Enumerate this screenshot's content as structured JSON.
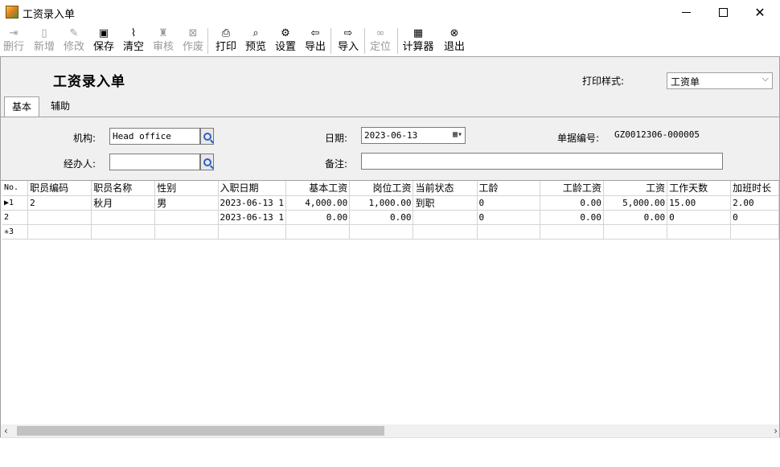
{
  "window": {
    "title": "工资录入单"
  },
  "toolbar": {
    "buttons": [
      {
        "label": "删行",
        "icon": "delete-row-icon",
        "glyph": "⇥",
        "disabled": true
      },
      {
        "label": "新增",
        "icon": "new-doc-icon",
        "glyph": "▯",
        "disabled": true
      },
      {
        "label": "修改",
        "icon": "edit-icon",
        "glyph": "✎",
        "disabled": true
      },
      {
        "label": "保存",
        "icon": "save-icon",
        "glyph": "▣",
        "disabled": false
      },
      {
        "label": "清空",
        "icon": "broom-icon",
        "glyph": "⌇",
        "disabled": false
      },
      {
        "label": "审核",
        "icon": "stamp-icon",
        "glyph": "♜",
        "disabled": true
      },
      {
        "label": "作废",
        "icon": "void-icon",
        "glyph": "⊠",
        "disabled": true
      },
      {
        "label": "打印",
        "icon": "printer-icon",
        "glyph": "⎙",
        "disabled": false
      },
      {
        "label": "预览",
        "icon": "preview-icon",
        "glyph": "⌕",
        "disabled": false
      },
      {
        "label": "设置",
        "icon": "settings-icon",
        "glyph": "⚙",
        "disabled": false
      },
      {
        "label": "导出",
        "icon": "export-icon",
        "glyph": "⇦",
        "disabled": false
      },
      {
        "label": "导入",
        "icon": "import-icon",
        "glyph": "⇨",
        "disabled": false
      },
      {
        "label": "定位",
        "icon": "binoculars-icon",
        "glyph": "∞",
        "disabled": true
      },
      {
        "label": "计算器",
        "icon": "calculator-icon",
        "glyph": "▦",
        "disabled": false
      },
      {
        "label": "退出",
        "icon": "exit-icon",
        "glyph": "⊗",
        "disabled": false
      }
    ]
  },
  "form": {
    "title": "工资录入单",
    "print_style_label": "打印样式:",
    "print_style_value": "工资单",
    "tabs": [
      "基本",
      "辅助"
    ],
    "org_label": "机构:",
    "org_value": "Head office",
    "handler_label": "经办人:",
    "handler_value": "",
    "date_label": "日期:",
    "date_value": "2023-06-13",
    "remark_label": "备注:",
    "remark_value": "",
    "doc_no_label": "单据编号:",
    "doc_no_value": "GZ0012306-000005"
  },
  "grid": {
    "columns": [
      "No.",
      "职员编码",
      "职员名称",
      "性别",
      "入职日期",
      "基本工资",
      "岗位工资",
      "当前状态",
      "工龄",
      "工龄工资",
      "工资",
      "工作天数",
      "加班时长"
    ],
    "rows": [
      {
        "no": "▶1",
        "emp_code": "2",
        "emp_name": "秋月",
        "gender": "男",
        "hire_date": "2023-06-13 1",
        "base_salary": "4,000.00",
        "post_salary": "1,000.00",
        "status": "到职",
        "seniority": "0",
        "seniority_pay": "0.00",
        "salary": "5,000.00",
        "work_days": "15.00",
        "overtime": "2.00"
      },
      {
        "no": "2",
        "emp_code": "",
        "emp_name": "",
        "gender": "",
        "hire_date": "2023-06-13 1",
        "base_salary": "0.00",
        "post_salary": "0.00",
        "status": "",
        "seniority": "0",
        "seniority_pay": "0.00",
        "salary": "0.00",
        "work_days": "0",
        "overtime": "0"
      },
      {
        "no": "✳3",
        "emp_code": "",
        "emp_name": "",
        "gender": "",
        "hire_date": "",
        "base_salary": "",
        "post_salary": "",
        "status": "",
        "seniority": "",
        "seniority_pay": "",
        "salary": "",
        "work_days": "",
        "overtime": ""
      }
    ]
  }
}
